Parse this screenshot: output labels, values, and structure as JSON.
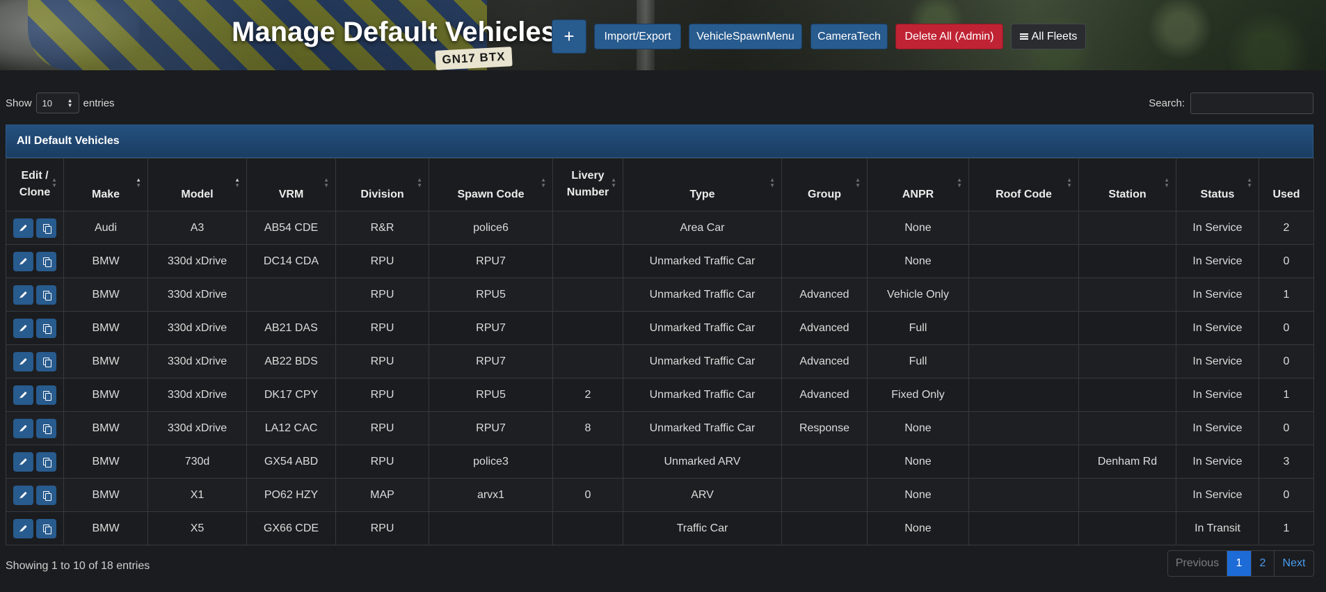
{
  "header": {
    "title": "Manage Default Vehicles",
    "plate_text": "GN17 BTX",
    "buttons": {
      "add": "+",
      "import_export": "Import/Export",
      "vehicle_spawn_menu": "VehicleSpawnMenu",
      "camera_tech": "CameraTech",
      "delete_all": "Delete All (Admin)",
      "all_fleets": "All Fleets"
    }
  },
  "controls": {
    "show_label": "Show",
    "entries_value": "10",
    "entries_label": "entries",
    "search_label": "Search:",
    "search_value": ""
  },
  "card": {
    "title": "All Default Vehicles"
  },
  "table": {
    "columns": [
      "Edit / Clone",
      "Make",
      "Model",
      "VRM",
      "Division",
      "Spawn Code",
      "Livery Number",
      "Type",
      "Group",
      "ANPR",
      "Roof Code",
      "Station",
      "Status",
      "Used"
    ],
    "rows": [
      [
        "",
        "Audi",
        "A3",
        "AB54 CDE",
        "R&R",
        "police6",
        "",
        "Area Car",
        "",
        "None",
        "",
        "",
        "In Service",
        "2"
      ],
      [
        "",
        "BMW",
        "330d xDrive",
        "DC14 CDA",
        "RPU",
        "RPU7",
        "",
        "Unmarked Traffic Car",
        "",
        "None",
        "",
        "",
        "In Service",
        "0"
      ],
      [
        "",
        "BMW",
        "330d xDrive",
        "",
        "RPU",
        "RPU5",
        "",
        "Unmarked Traffic Car",
        "Advanced",
        "Vehicle Only",
        "",
        "",
        "In Service",
        "1"
      ],
      [
        "",
        "BMW",
        "330d xDrive",
        "AB21 DAS",
        "RPU",
        "RPU7",
        "",
        "Unmarked Traffic Car",
        "Advanced",
        "Full",
        "",
        "",
        "In Service",
        "0"
      ],
      [
        "",
        "BMW",
        "330d xDrive",
        "AB22 BDS",
        "RPU",
        "RPU7",
        "",
        "Unmarked Traffic Car",
        "Advanced",
        "Full",
        "",
        "",
        "In Service",
        "0"
      ],
      [
        "",
        "BMW",
        "330d xDrive",
        "DK17 CPY",
        "RPU",
        "RPU5",
        "2",
        "Unmarked Traffic Car",
        "Advanced",
        "Fixed Only",
        "",
        "",
        "In Service",
        "1"
      ],
      [
        "",
        "BMW",
        "330d xDrive",
        "LA12 CAC",
        "RPU",
        "RPU7",
        "8",
        "Unmarked Traffic Car",
        "Response",
        "None",
        "",
        "",
        "In Service",
        "0"
      ],
      [
        "",
        "BMW",
        "730d",
        "GX54 ABD",
        "RPU",
        "police3",
        "",
        "Unmarked ARV",
        "",
        "None",
        "",
        "Denham Rd",
        "In Service",
        "3"
      ],
      [
        "",
        "BMW",
        "X1",
        "PO62 HZY",
        "MAP",
        "arvx1",
        "0",
        "ARV",
        "",
        "None",
        "",
        "",
        "In Service",
        "0"
      ],
      [
        "",
        "BMW",
        "X5",
        "GX66 CDE",
        "RPU",
        "",
        "",
        "Traffic Car",
        "",
        "None",
        "",
        "",
        "In Transit",
        "1"
      ]
    ]
  },
  "footer": {
    "info": "Showing 1 to 10 of 18 entries",
    "pager": {
      "previous": "Previous",
      "page1": "1",
      "page2": "2",
      "next": "Next"
    }
  },
  "colors": {
    "primary": "#285b8e",
    "danger": "#c02334",
    "background": "#1b1c1f",
    "active_page": "#1d6bd6"
  }
}
